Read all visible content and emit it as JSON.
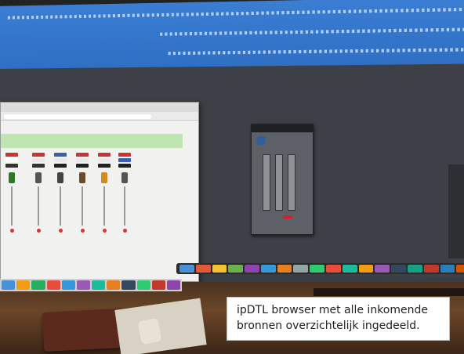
{
  "caption": {
    "line1": "ipDTL browser met alle inkomende",
    "line2": "bronnen overzichtelijk ingedeeld."
  },
  "colors": {
    "daw_blue": "#3b7fd4",
    "desktop_gray": "#3d4046",
    "browser_green": "#bfe6b0",
    "desk_wood": "#6b4628",
    "caption_bg": "#ffffff"
  }
}
